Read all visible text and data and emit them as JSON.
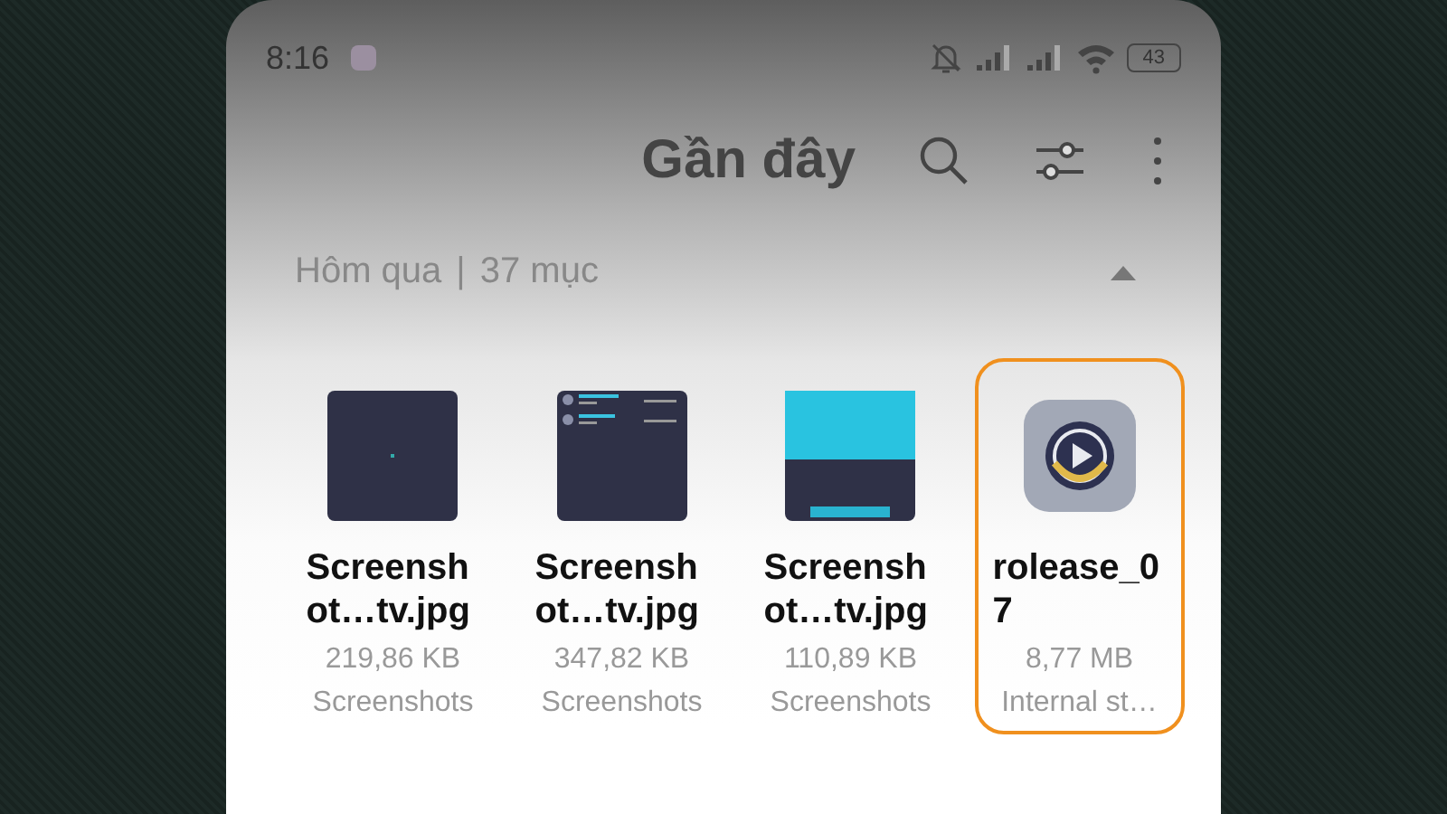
{
  "status_bar": {
    "time": "8:16",
    "battery": "43"
  },
  "header": {
    "title": "Gần đây"
  },
  "section": {
    "label": "Hôm qua",
    "separator": "|",
    "count": "37 mục",
    "expanded": true
  },
  "files": [
    {
      "kind": "screenshot",
      "name": "Screenshot…tv.jpg",
      "size": "219,86 KB",
      "location": "Screenshots",
      "selected": false
    },
    {
      "kind": "screenshot",
      "name": "Screenshot…tv.jpg",
      "size": "347,82 KB",
      "location": "Screenshots",
      "selected": false
    },
    {
      "kind": "screenshot",
      "name": "Screenshot…tv.jpg",
      "size": "110,89 KB",
      "location": "Screenshots",
      "selected": false
    },
    {
      "kind": "app",
      "name": "rolease_07",
      "size": "8,77 MB",
      "location": "Internal st…",
      "selected": true
    }
  ]
}
